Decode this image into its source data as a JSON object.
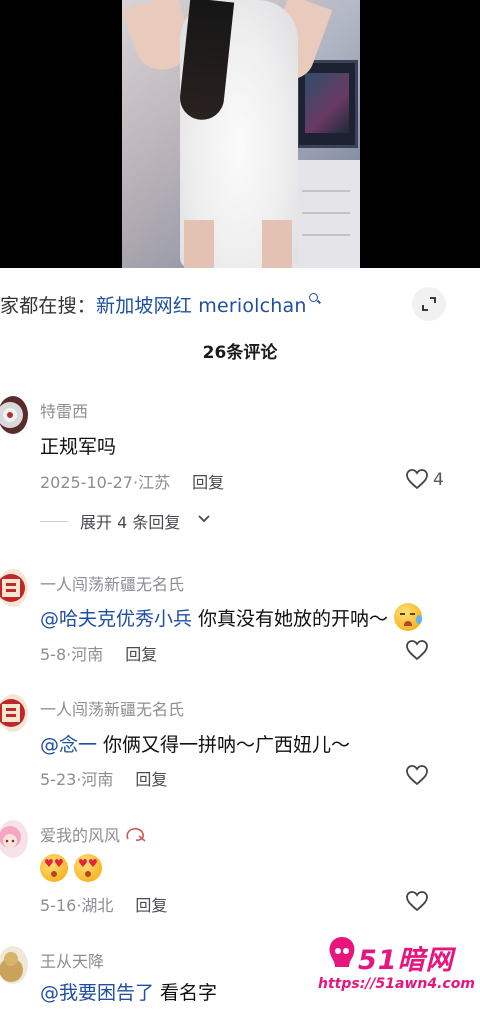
{
  "search": {
    "prefix": "家都在搜：",
    "keyword": "新加坡网红 meriolchan"
  },
  "comment_count": "26条评论",
  "comments": [
    {
      "username": "特雷西",
      "text": "正规军吗",
      "date": "2025-10-27",
      "location": "江苏",
      "reply_label": "回复",
      "likes": "4",
      "replies_toggle": "展开 4 条回复"
    },
    {
      "username": "一人闯荡新疆无名氏",
      "mention": "@哈夫克优秀小兵",
      "text": " 你真没有她放的开呐～",
      "emoji": "crying-face",
      "date": "5-8",
      "location": "河南",
      "reply_label": "回复"
    },
    {
      "username": "一人闯荡新疆无名氏",
      "mention": "@念一",
      "text": " 你俩又得一拼呐～广西妞儿～",
      "date": "5-23",
      "location": "河南",
      "reply_label": "回复"
    },
    {
      "username": "爱我的风风",
      "emoji": "heart-eyes-face",
      "date": "5-16",
      "location": "湖北",
      "reply_label": "回复"
    },
    {
      "username": "王从天降",
      "mention": "@我要困告了",
      "text": " 看名字"
    }
  ],
  "watermark": {
    "title": "51暗网",
    "url": "https://51awn4.com"
  },
  "colors": {
    "mention": "#1f4fa3",
    "watermark": "#e8157e",
    "meta": "#8d8d92"
  }
}
